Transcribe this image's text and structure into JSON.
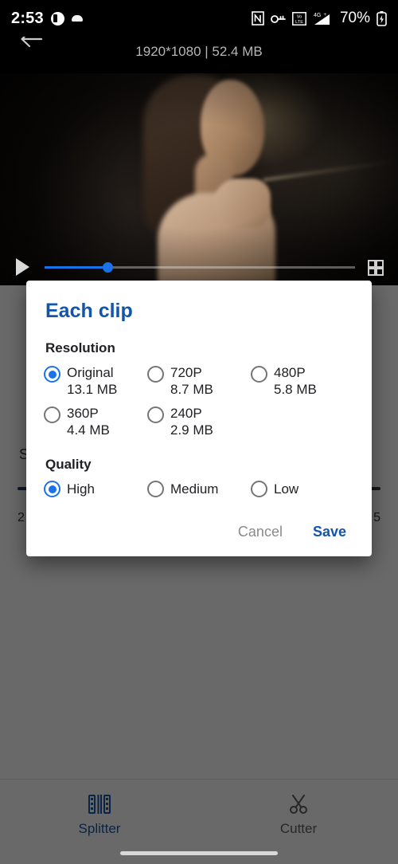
{
  "status_bar": {
    "time": "2:53",
    "battery_percent": "70%",
    "icons": [
      "circle-half-icon",
      "cloud-icon",
      "nfc-icon",
      "vpn-key-icon",
      "volte-icon",
      "signal-4g-plus-icon",
      "battery-icon"
    ]
  },
  "toolbar": {
    "title": "1920*1080 | 52.4 MB",
    "back_label": "back-arrow"
  },
  "player": {
    "play_label": "play",
    "fullscreen_label": "fullscreen",
    "progress_percent": 20
  },
  "background": {
    "section_letter": "S",
    "tick_left": "2",
    "tick_right": "5"
  },
  "dialog": {
    "title": "Each clip",
    "resolution": {
      "label": "Resolution",
      "options": [
        {
          "name": "Original",
          "size": "13.1 MB",
          "selected": true
        },
        {
          "name": "720P",
          "size": "8.7 MB",
          "selected": false
        },
        {
          "name": "480P",
          "size": "5.8 MB",
          "selected": false
        },
        {
          "name": "360P",
          "size": "4.4 MB",
          "selected": false
        },
        {
          "name": "240P",
          "size": "2.9 MB",
          "selected": false
        }
      ]
    },
    "quality": {
      "label": "Quality",
      "options": [
        {
          "name": "High",
          "selected": true
        },
        {
          "name": "Medium",
          "selected": false
        },
        {
          "name": "Low",
          "selected": false
        }
      ]
    },
    "cancel_label": "Cancel",
    "save_label": "Save"
  },
  "bottom_nav": {
    "items": [
      {
        "label": "Splitter",
        "icon": "splitter-icon",
        "active": true
      },
      {
        "label": "Cutter",
        "icon": "scissors-icon",
        "active": false
      }
    ]
  },
  "colors": {
    "accent_blue": "#1256ab",
    "radio_blue": "#1a73e8",
    "nav_active": "#1a56a8",
    "nav_inactive": "#5e5e5e"
  }
}
